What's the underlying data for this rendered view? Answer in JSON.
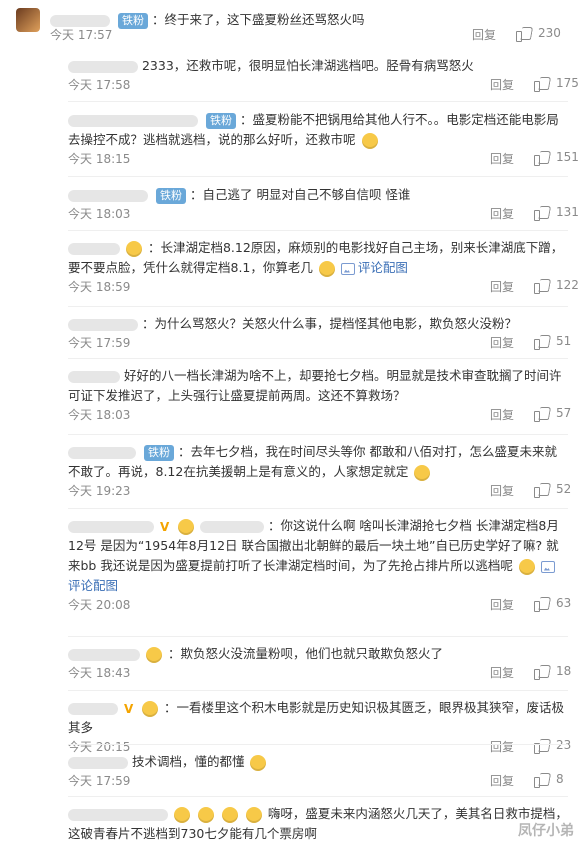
{
  "top": {
    "badge": "铁粉",
    "text": "：终于来了，这下盛夏粉丝还骂怒火吗",
    "time": "今天 17:57",
    "reply": "回复",
    "likes": "230"
  },
  "comments": [
    {
      "badge": "",
      "text": "2333，还救市呢，很明显怕长津湖逃档吧。胫骨有病骂怒火",
      "time": "今天 17:58",
      "reply": "回复",
      "likes": "175"
    },
    {
      "badge": "铁粉",
      "text": "：盛夏粉能不把锅甩给其他人行不。。电影定档还能电影局去操控不成？逃档就逃档，说的那么好听，还救市呢",
      "time": "今天 18:15",
      "reply": "回复",
      "likes": "151"
    },
    {
      "badge": "铁粉",
      "text": "：自己逃了  明显对自己不够自信呗  怪谁",
      "time": "今天 18:03",
      "reply": "回复",
      "likes": "131"
    },
    {
      "badge": "",
      "text": "：长津湖定档8.12原因，麻烦别的电影找好自己主场，别来长津湖底下蹭，要不要点脸，凭什么就得定档8.1，你算老几",
      "link": "评论配图",
      "time": "今天 18:59",
      "reply": "回复",
      "likes": "122"
    },
    {
      "badge": "",
      "text": "：为什么骂怒火？关怒火什么事，提档怪其他电影，欺负怒火没粉？",
      "time": "今天 17:59",
      "reply": "回复",
      "likes": "51"
    },
    {
      "badge": "",
      "text": "好好的八一档长津湖为啥不上，却要抢七夕档。明显就是技术审查耽搁了时间许可证下发推迟了，上头强行让盛夏提前两周。这还不算救场？",
      "time": "今天 18:03",
      "reply": "回复",
      "likes": "57"
    },
    {
      "badge": "铁粉",
      "text": "：去年七夕档，我在时间尽头等你 都敢和八佰对打，怎么盛夏未来就不敢了。再说，8.12在抗美援朝上是有意义的，人家想定就定",
      "time": "今天 19:23",
      "reply": "回复",
      "likes": "52"
    },
    {
      "badge": "",
      "text": "：你这说什么啊 啥叫长津湖抢七夕档 长津湖定档8月12号 是因为“1954年8月12日 联合国撤出北朝鲜的最后一块土地”自已历史学好了嘛? 就来bb 我还说是因为盛夏提前打听了长津湖定档时间，为了先抢占排片所以逃档呢",
      "link": "评论配图",
      "time": "今天 20:08",
      "reply": "回复",
      "likes": "63"
    },
    {
      "badge": "",
      "text": "：欺负怒火没流量粉呗，他们也就只敢欺负怒火了",
      "time": "今天 18:43",
      "reply": "回复",
      "likes": "18"
    },
    {
      "badge": "",
      "text": "：一看楼里这个积木电影就是历史知识极其匮乏，眼界极其狭窄，废话极其多",
      "time": "今天 20:15",
      "reply": "回复",
      "likes": "23"
    },
    {
      "badge": "",
      "text": "技术调档，懂的都懂",
      "time": "今天 17:59",
      "reply": "回复",
      "likes": "8"
    },
    {
      "badge": "",
      "text": "嗨呀，盛夏未来内涵怒火几天了，美其名日救市提档，这破青春片不逃档到730七夕能有几个票房啊",
      "time": "",
      "reply": "",
      "likes": ""
    }
  ],
  "watermark": "凤仔小弟"
}
